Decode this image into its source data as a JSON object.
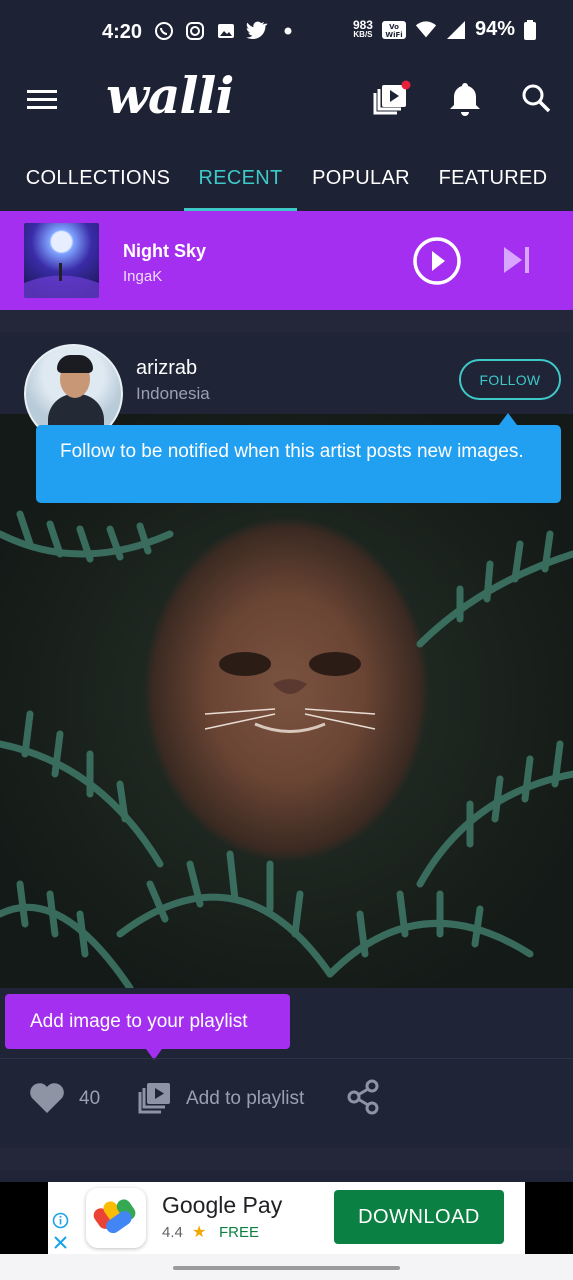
{
  "status_bar": {
    "time": "4:20",
    "net_speed_value": "983",
    "net_speed_unit": "KB/S",
    "battery": "94%"
  },
  "app": {
    "logo": "walli"
  },
  "tabs": [
    {
      "label": "COLLECTIONS"
    },
    {
      "label": "RECENT"
    },
    {
      "label": "POPULAR"
    },
    {
      "label": "FEATURED"
    }
  ],
  "active_tab": "RECENT",
  "player": {
    "title": "Night Sky",
    "artist": "IngaK"
  },
  "post": {
    "artist_name": "arizrab",
    "artist_country": "Indonesia",
    "follow_label": "FOLLOW",
    "follow_tooltip": "Follow to be notified when this artist posts new images.",
    "playlist_tooltip": "Add image to your playlist",
    "likes": "40",
    "add_to_playlist_label": "Add to playlist"
  },
  "ad": {
    "title": "Google Pay",
    "rating": "4.4",
    "price": "FREE",
    "cta": "DOWNLOAD"
  },
  "colors": {
    "background": "#1e2235",
    "accent_teal": "#3ec9c9",
    "player_purple": "#a42ff0",
    "tooltip_blue": "#21a0f2",
    "ad_green": "#0b8043"
  }
}
